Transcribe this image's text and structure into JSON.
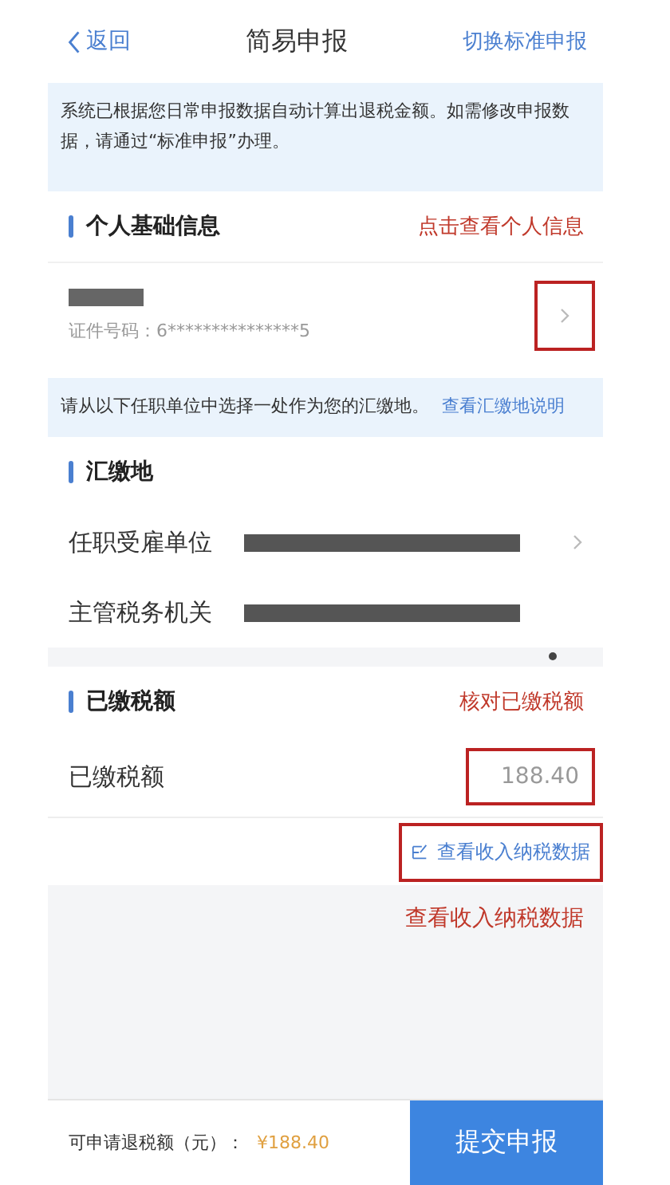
{
  "header": {
    "back": "返回",
    "title": "简易申报",
    "action": "切换标准申报"
  },
  "notice": "系统已根据您日常申报数据自动计算出退税金额。如需修改申报数据，请通过“标准申报”办理。",
  "personal": {
    "title": "个人基础信息",
    "annotation": "点击查看个人信息",
    "id_line": "证件号码：6***************5"
  },
  "place_notice": {
    "text": "请从以下任职单位中选择一处作为您的汇缴地。",
    "link": "查看汇缴地说明"
  },
  "place": {
    "title": "汇缴地",
    "rows": [
      {
        "label": "任职受雇单位",
        "chevron": true
      },
      {
        "label": "主管税务机关",
        "chevron": false
      }
    ]
  },
  "paid": {
    "title": "已缴税额",
    "annotation": "核对已缴税额",
    "label": "已缴税额",
    "amount": "188.40",
    "link": "查看收入纳税数据",
    "link_annotation": "查看收入纳税数据"
  },
  "footer": {
    "label": "可申请退税额（元）：",
    "amount": "¥188.40",
    "submit": "提交申报"
  }
}
